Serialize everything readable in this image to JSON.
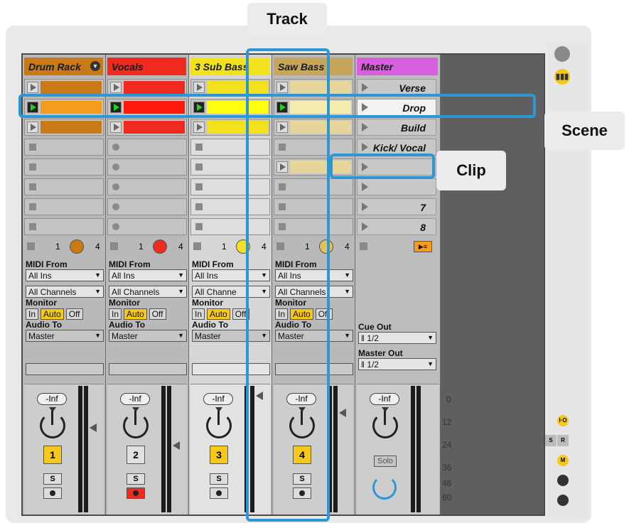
{
  "callouts": {
    "track": "Track",
    "scene": "Scene",
    "clip": "Clip"
  },
  "tracks": [
    {
      "name": "Drum Rack",
      "color": "#c97a16",
      "clipColor": "#c97a16",
      "number": "1",
      "numberOn": true,
      "armed": false,
      "dotColor": "#c97a16"
    },
    {
      "name": "Vocals",
      "color": "#ef2b1f",
      "clipColor": "#ef2b1f",
      "number": "2",
      "numberOn": false,
      "armed": true,
      "dotColor": "#ef2b1f"
    },
    {
      "name": "3 Sub Bass",
      "color": "#f2e11d",
      "clipColor": "#f2e11d",
      "number": "3",
      "numberOn": true,
      "armed": false,
      "dotColor": "#f2e11d"
    },
    {
      "name": "Saw Bass",
      "color": "#c7a65a",
      "clipColor": "#e6d69a",
      "number": "4",
      "numberOn": true,
      "armed": false,
      "dotColor": "#e0c060"
    }
  ],
  "master": {
    "name": "Master",
    "color": "#d85fe0"
  },
  "scenes": [
    "Verse",
    "Drop",
    "Build",
    "Kick/ Vocal",
    "",
    "",
    "7",
    "8"
  ],
  "strip": {
    "num1": "1",
    "num4": "4"
  },
  "io": {
    "midi_from_label": "MIDI From",
    "midi_from_value": "All Ins",
    "channels_value": "All Channels",
    "channels_value_short": "All Channe",
    "monitor_label": "Monitor",
    "monitor_in": "In",
    "monitor_auto": "Auto",
    "monitor_off": "Off",
    "audio_to_label": "Audio To",
    "audio_to_value": "Master"
  },
  "master_io": {
    "cue_out_label": "Cue Out",
    "cue_out_value": "1/2",
    "master_out_label": "Master Out",
    "master_out_value": "1/2"
  },
  "mixer": {
    "volume": "-Inf",
    "solo_label": "S",
    "master_solo_label": "Solo",
    "scale": [
      "0",
      "12",
      "24",
      "36",
      "48",
      "60"
    ]
  },
  "side_buttons": {
    "io": "I·O",
    "s": "S",
    "r": "R",
    "m": "M"
  },
  "colors": {
    "accent_blue": "#2d97d6",
    "arm_yellow": "#f6c81c"
  }
}
